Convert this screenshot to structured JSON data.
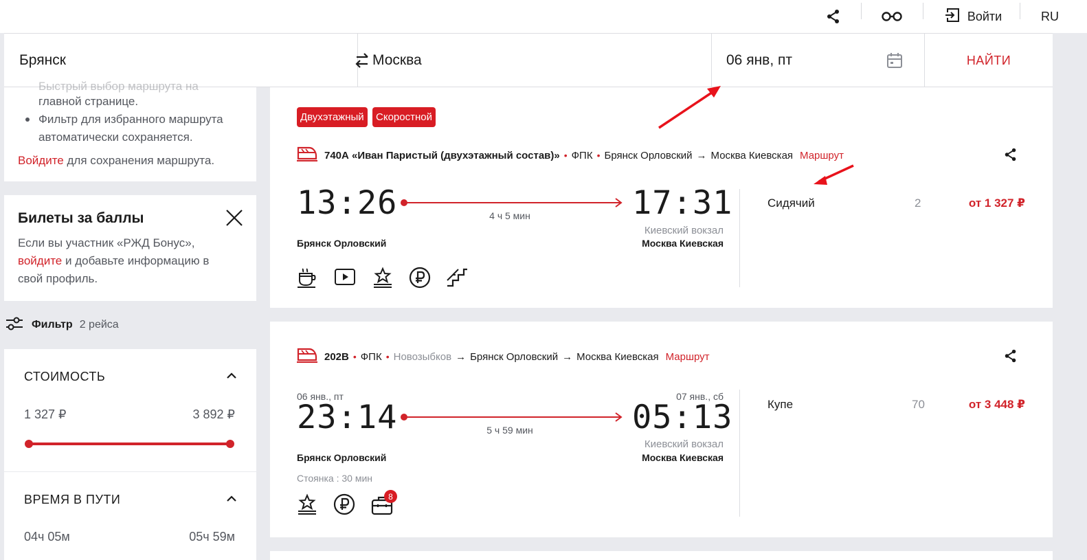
{
  "topbar": {
    "login_label": "Войти",
    "lang_label": "RU"
  },
  "search": {
    "from": "Брянск",
    "to": "Москва",
    "date": "06 янв, пт",
    "find_label": "НАЙТИ"
  },
  "sidebar": {
    "features_cut": "Быстрый выбор маршрута на",
    "features_line2": "главной странице.",
    "feature2_line1": "Фильтр для избранного маршрута",
    "feature2_line2": "автоматически сохраняется.",
    "login_link": "Войдите",
    "login_suffix": " для сохранения маршрута.",
    "bonus": {
      "title": "Билеты за баллы",
      "text1": "Если вы участник «РЖД Бонус»,",
      "link": "войдите",
      "text2_suffix": " и добавьте информацию в",
      "text3": "свой профиль."
    },
    "filter": {
      "label": "Фильтр",
      "count": "2 рейса"
    },
    "cost": {
      "title": "СТОИМОСТЬ",
      "min": "1 327 ₽",
      "max": "3 892 ₽"
    },
    "time": {
      "title": "ВРЕМЯ В ПУТИ",
      "min": "04ч 05м",
      "max": "05ч 59м"
    }
  },
  "trains": [
    {
      "badges": [
        "Двухэтажный",
        "Скоростной"
      ],
      "number": "740А «Иван Паристый (двухэтажный состав)»",
      "carrier": "ФПК",
      "from_station": "Брянск Орловский",
      "to_station": "Москва Киевская",
      "route_label": "Маршрут",
      "dep_time": "13:26",
      "arr_time": "17:31",
      "duration": "4 ч 5 мин",
      "dep_station": "Брянск Орловский",
      "arr_vokzal": "Киевский вокзал",
      "arr_station": "Москва Киевская",
      "class_name": "Сидячий",
      "seats": "2",
      "price": "от 1 327 ₽"
    },
    {
      "number": "202В",
      "carrier": "ФПК",
      "origin": "Новозыбков",
      "from_station": "Брянск Орловский",
      "to_station": "Москва Киевская",
      "route_label": "Маршрут",
      "dep_date": "06 янв., пт",
      "arr_date": "07 янв., сб",
      "dep_time": "23:14",
      "arr_time": "05:13",
      "duration": "5 ч 59 мин",
      "dep_station": "Брянск Орловский",
      "stop": "Стоянка : 30 мин",
      "arr_vokzal": "Киевский вокзал",
      "arr_station": "Москва Киевская",
      "class_name": "Купе",
      "seats": "70",
      "price": "от 3 448 ₽",
      "luggage_badge": "8"
    }
  ],
  "colors": {
    "accent": "#d1232a",
    "annotation_arrow": "#e8121b"
  }
}
